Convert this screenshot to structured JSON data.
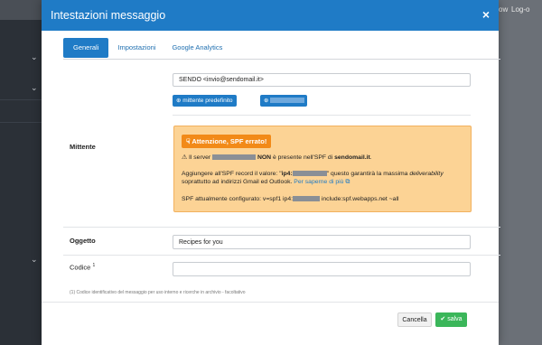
{
  "background": {
    "top_right_items": [
      "ow",
      "Log-o"
    ]
  },
  "modal": {
    "title": "Intestazioni messaggio",
    "close_glyph": "×",
    "tabs": [
      "Generali",
      "Impostazioni",
      "Google Analytics"
    ],
    "sender": {
      "label": "Mittente",
      "value": "SENDO <invio@sendomail.it>",
      "default_button": "mittente predefinito"
    },
    "spf_warning": {
      "badge": "Attenzione, SPF errato!",
      "line1_pre": "Il server",
      "line1_bold": "NON",
      "line1_post": "è presente nell'SPF di",
      "line1_domain": "sendomail.it",
      "line1_end": ".",
      "line2_pre": "Aggiungere all'SPF record il valore: \"",
      "line2_code": "ip4:",
      "line2_post": "\" questo garantirà la massima",
      "line2_emph": "deliverability",
      "line3_pre": "soprattutto ad indirizzi Gmail ed Outlook.",
      "line3_link": "Per saperne di più",
      "line4_pre": "SPF attualmente configurato: v=spf1 ip4:",
      "line4_post": "include:spf.webapps.net ~all"
    },
    "subject": {
      "label": "Oggetto",
      "value": "Recipes for you"
    },
    "code": {
      "label": "Codice",
      "superscript": "1",
      "value": ""
    },
    "footnote": {
      "mark": "(1)",
      "text": "Codice identificativo del messaggio per uso interno e ricerche in archivio - facoltativo"
    },
    "buttons": {
      "cancel": "Cancella",
      "save": "salva"
    }
  },
  "colors": {
    "header": "#1f7bc6",
    "warning_bg": "#fcd395",
    "warning_badge": "#f28a18",
    "save": "#3bb65a"
  }
}
